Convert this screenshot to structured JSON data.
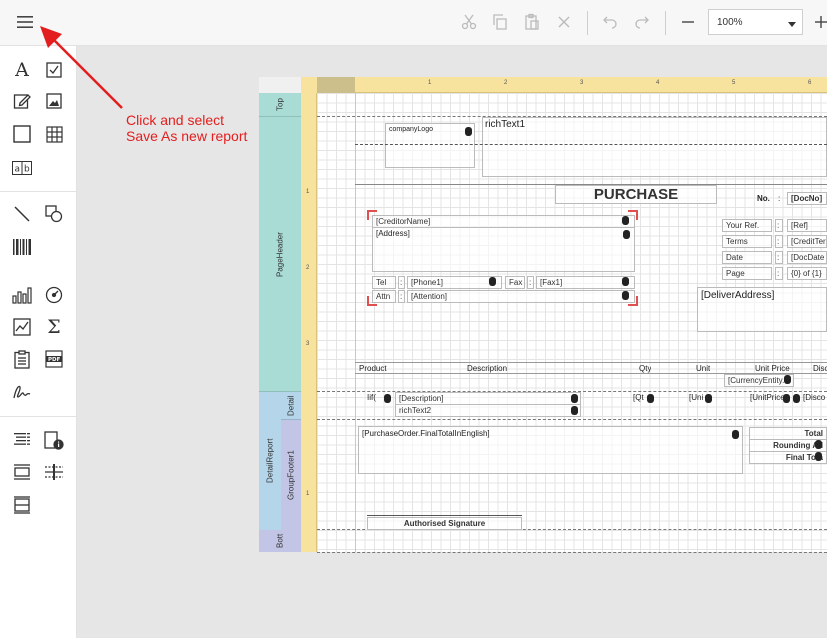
{
  "toolbar": {
    "menu_icon": "hamburger-icon",
    "cut_icon": "scissors-icon",
    "copy_icon": "copy-icon",
    "paste_icon": "paste-icon",
    "delete_icon": "close-icon",
    "undo_icon": "undo-icon",
    "redo_icon": "redo-icon",
    "zoom_out_icon": "minus-icon",
    "zoom_value": "100%",
    "zoom_in_icon": "plus-icon"
  },
  "annotation": {
    "line1": "Click and select",
    "line2": "Save As new report",
    "color": "#e31e1e"
  },
  "toolbox": {
    "items": [
      "label-tool",
      "checkbox-tool",
      "richtext-tool",
      "picture-tool",
      "panel-tool",
      "table-tool",
      "charactercomb-tool",
      "line-tool",
      "shape-tool",
      "barcode-tool",
      "chart-tool",
      "gauge-tool",
      "sparkline-tool",
      "summary-tool",
      "pagebreak-tool",
      "pdf-tool",
      "signature-tool",
      "toc-tool",
      "pageinfo-tool",
      "subreport-tool",
      "crossband-tool",
      "crossline-tool"
    ]
  },
  "ruler": {
    "top_numbers": [
      "1",
      "2",
      "3",
      "4",
      "5",
      "6"
    ],
    "left_numbers_header": [
      "1",
      "2",
      "3"
    ],
    "left_numbers_footer": [
      "1"
    ]
  },
  "bands": {
    "top": "Top",
    "page_header": "PageHeader",
    "detail": "Detail",
    "detail_report": "DetailReport",
    "group_footer": "GroupFooter1",
    "bottom": "Bott"
  },
  "report": {
    "company_logo": "companyLogo",
    "rich_text1": "richText1",
    "title": "PURCHASE",
    "no_label": "No.",
    "no_colon": ":",
    "doc_no": "[DocNo]",
    "creditor_name": "[CreditorName]",
    "address": "[Address]",
    "tel_label": "Tel",
    "tel_colon": ":",
    "phone": "[Phone1]",
    "fax_label": "Fax",
    "fax_colon": ":",
    "fax": "[Fax1]",
    "attn_label": "Attn",
    "attn_colon": ":",
    "attention": "[Attention]",
    "your_ref_label": "Your Ref.",
    "your_ref_colon": ":",
    "ref": "[Ref]",
    "terms_label": "Terms",
    "terms_colon": ":",
    "credit_term": "[CreditTer",
    "date_label": "Date",
    "date_colon": ":",
    "doc_date": "[DocDate",
    "page_label": "Page",
    "page_colon": ":",
    "page_value": "{0} of {1}",
    "deliver_address": "[DeliverAddress]",
    "col_product": "Product",
    "col_description": "Description",
    "col_qty": "Qty",
    "col_unit": "Unit",
    "col_unit_price": "Unit Price",
    "col_disc": "Disc",
    "currency_entity": "[CurrencyEntity.",
    "detail_iif": "Iif(",
    "detail_description": "[Description]",
    "detail_qty": "[Qt",
    "detail_unit": "[Uni",
    "detail_unit_price": "[UnitPrice",
    "detail_disc": "[Disco",
    "rich_text2": "richText2",
    "final_total_english": "[PurchaseOrder.FinalTotalInEnglish]",
    "total_label": "Total",
    "rounding_label": "Rounding Ad",
    "final_total_label": "Final Tota",
    "authorised_signature": "Authorised Signature"
  }
}
